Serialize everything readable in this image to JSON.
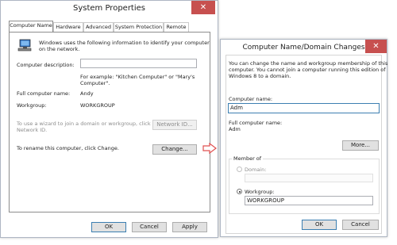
{
  "left_dialog": {
    "title": "System Properties",
    "close_glyph": "✕",
    "tabs": [
      "Computer Name",
      "Hardware",
      "Advanced",
      "System Protection",
      "Remote"
    ],
    "intro_text_1": "Windows uses the following information to identify your computer",
    "intro_text_2": "on the network.",
    "description_label": "Computer description:",
    "description_value": "",
    "example_line_1": "For example: \"Kitchen Computer\" or \"Mary's",
    "example_line_2": "Computer\".",
    "full_name_label": "Full computer name:",
    "full_name_value": "Andy",
    "workgroup_label": "Workgroup:",
    "workgroup_value": "WORKGROUP",
    "wizard_text_1": "To use a wizard to join a domain or workgroup, click",
    "wizard_text_2": "Network ID.",
    "network_id_button": "Network ID...",
    "rename_text": "To rename this computer, click Change.",
    "change_button": "Change...",
    "ok_button": "OK",
    "cancel_button": "Cancel",
    "apply_button": "Apply"
  },
  "arrow_icon": "arrow-right-icon",
  "right_dialog": {
    "title": "Computer Name/Domain Changes",
    "close_glyph": "✕",
    "intro_1": "You can change the name and workgroup membership of this",
    "intro_2": "computer. You cannot join a computer running this edition of",
    "intro_3": "Windows 8 to a domain.",
    "computer_name_label": "Computer name:",
    "computer_name_value": "Adm",
    "full_name_label": "Full computer name:",
    "full_name_value": "Adm",
    "more_button": "More...",
    "member_of_label": "Member of",
    "domain_label": "Domain:",
    "domain_value": "",
    "workgroup_label": "Workgroup:",
    "workgroup_value": "WORKGROUP",
    "ok_button": "OK",
    "cancel_button": "Cancel"
  },
  "colors": {
    "close": "#c7504f",
    "accent_border": "#3c7fb1",
    "arrow": "#e05050"
  }
}
